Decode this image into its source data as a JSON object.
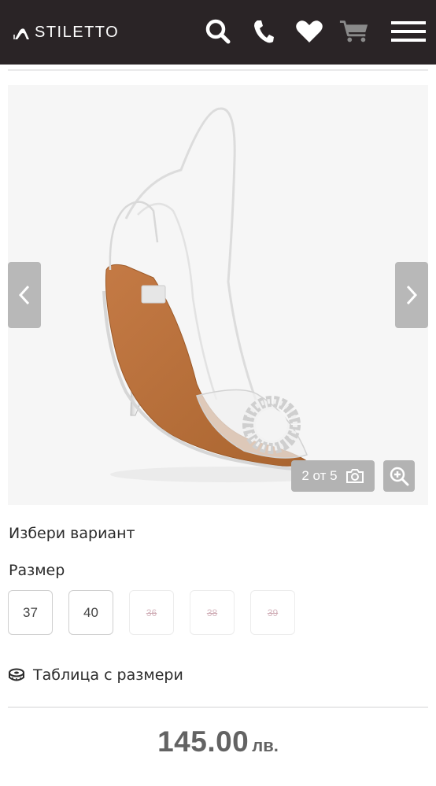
{
  "header": {
    "brand": "STILETTO",
    "icons": [
      "search-icon",
      "phone-icon",
      "heart-icon",
      "cart-icon",
      "menu-icon"
    ],
    "background": "#2a2426"
  },
  "gallery": {
    "counter": "2 от 5",
    "current": 2,
    "total": 5
  },
  "variant": {
    "heading": "Избери вариант",
    "size_label": "Размер",
    "sizes": [
      {
        "label": "37",
        "available": true
      },
      {
        "label": "40",
        "available": true
      },
      {
        "label": "36",
        "available": false
      },
      {
        "label": "38",
        "available": false
      },
      {
        "label": "39",
        "available": false
      }
    ],
    "size_table": "Таблица с размери"
  },
  "price": {
    "amount": "145.00",
    "currency": "лв."
  }
}
